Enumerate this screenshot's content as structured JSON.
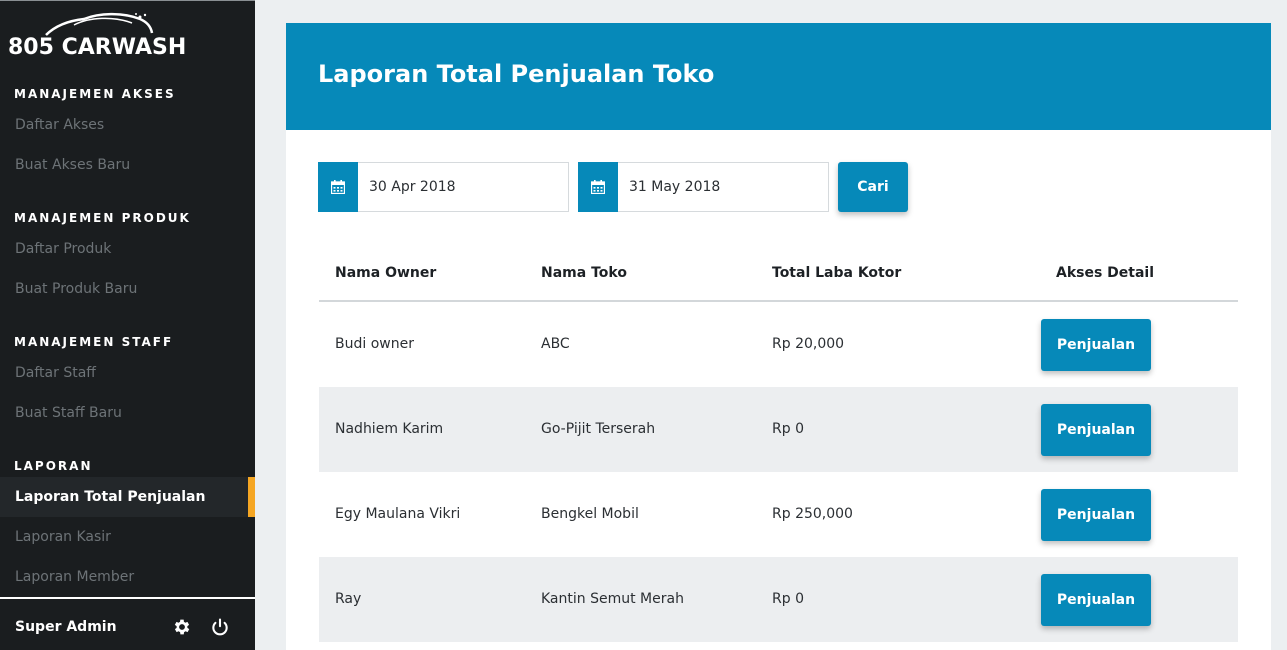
{
  "app": {
    "logo_text": "805 CARWASH"
  },
  "sidebar": {
    "sections": [
      {
        "title": "MANAJEMEN AKSES",
        "items": [
          {
            "label": "Daftar Akses"
          },
          {
            "label": "Buat Akses Baru"
          }
        ]
      },
      {
        "title": "MANAJEMEN PRODUK",
        "items": [
          {
            "label": "Daftar Produk"
          },
          {
            "label": "Buat Produk Baru"
          }
        ]
      },
      {
        "title": "MANAJEMEN STAFF",
        "items": [
          {
            "label": "Daftar Staff"
          },
          {
            "label": "Buat Staff Baru"
          }
        ]
      },
      {
        "title": "LAPORAN",
        "items": [
          {
            "label": "Laporan Total Penjualan",
            "active": true
          },
          {
            "label": "Laporan Kasir"
          },
          {
            "label": "Laporan Member"
          }
        ]
      }
    ],
    "footer": {
      "user_name": "Super Admin",
      "settings_icon": "gear-icon",
      "logout_icon": "power-icon"
    }
  },
  "main": {
    "title": "Laporan Total Penjualan Toko",
    "filters": {
      "start_date": "30 Apr 2018",
      "end_date": "31 May 2018",
      "search_label": "Cari",
      "date_icon": "calendar-icon"
    },
    "table": {
      "headers": [
        "Nama Owner",
        "Nama Toko",
        "Total Laba Kotor",
        "Akses Detail"
      ],
      "rows": [
        {
          "owner": "Budi owner",
          "store": "ABC",
          "total": "Rp 20,000",
          "action": "Penjualan"
        },
        {
          "owner": "Nadhiem Karim",
          "store": "Go-Pijit Terserah",
          "total": "Rp 0",
          "action": "Penjualan"
        },
        {
          "owner": "Egy Maulana Vikri",
          "store": "Bengkel Mobil",
          "total": "Rp 250,000",
          "action": "Penjualan"
        },
        {
          "owner": "Ray",
          "store": "Kantin Semut Merah",
          "total": "Rp 0",
          "action": "Penjualan"
        }
      ]
    }
  },
  "colors": {
    "primary": "#0689b9",
    "sidebar_bg": "#1a1d1f",
    "active_accent": "#f5a623",
    "row_alt": "#eceef0"
  }
}
